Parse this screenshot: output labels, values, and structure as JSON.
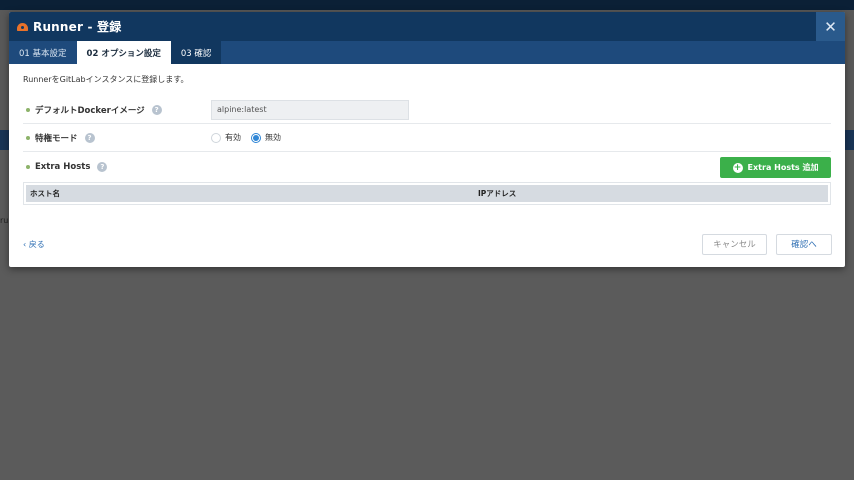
{
  "modal": {
    "title": "Runner - 登録",
    "close_symbol": "✕",
    "icon": "runner-icon"
  },
  "tabs": [
    {
      "label": "01 基本設定",
      "state": "default"
    },
    {
      "label": "02 オプション設定",
      "state": "active"
    },
    {
      "label": "03 確認",
      "state": "default"
    }
  ],
  "intro_text": "RunnerをGitLabインスタンスに登録します。",
  "form": {
    "docker_image": {
      "label": "デフォルトDockerイメージ",
      "value": "alpine:latest"
    },
    "privileged": {
      "label": "特権モード",
      "options": [
        "有効",
        "無効"
      ],
      "selected": "無効"
    },
    "extra_hosts": {
      "label": "Extra Hosts",
      "add_button": "Extra Hosts 追加",
      "columns": [
        "ホスト名",
        "IPアドレス"
      ],
      "rows": []
    },
    "help_symbol": "?"
  },
  "footer": {
    "back_label": "‹ 戻る",
    "cancel_label": "キャンセル",
    "confirm_label": "確認へ"
  },
  "background": {
    "partial_text": "ru"
  },
  "colors": {
    "header": "#11375f",
    "tabs": "#1e4a7c",
    "add_button": "#3bb04a",
    "link": "#2f6fb3",
    "radio_selected": "#2f86d6",
    "bullet": "#8db36a"
  }
}
